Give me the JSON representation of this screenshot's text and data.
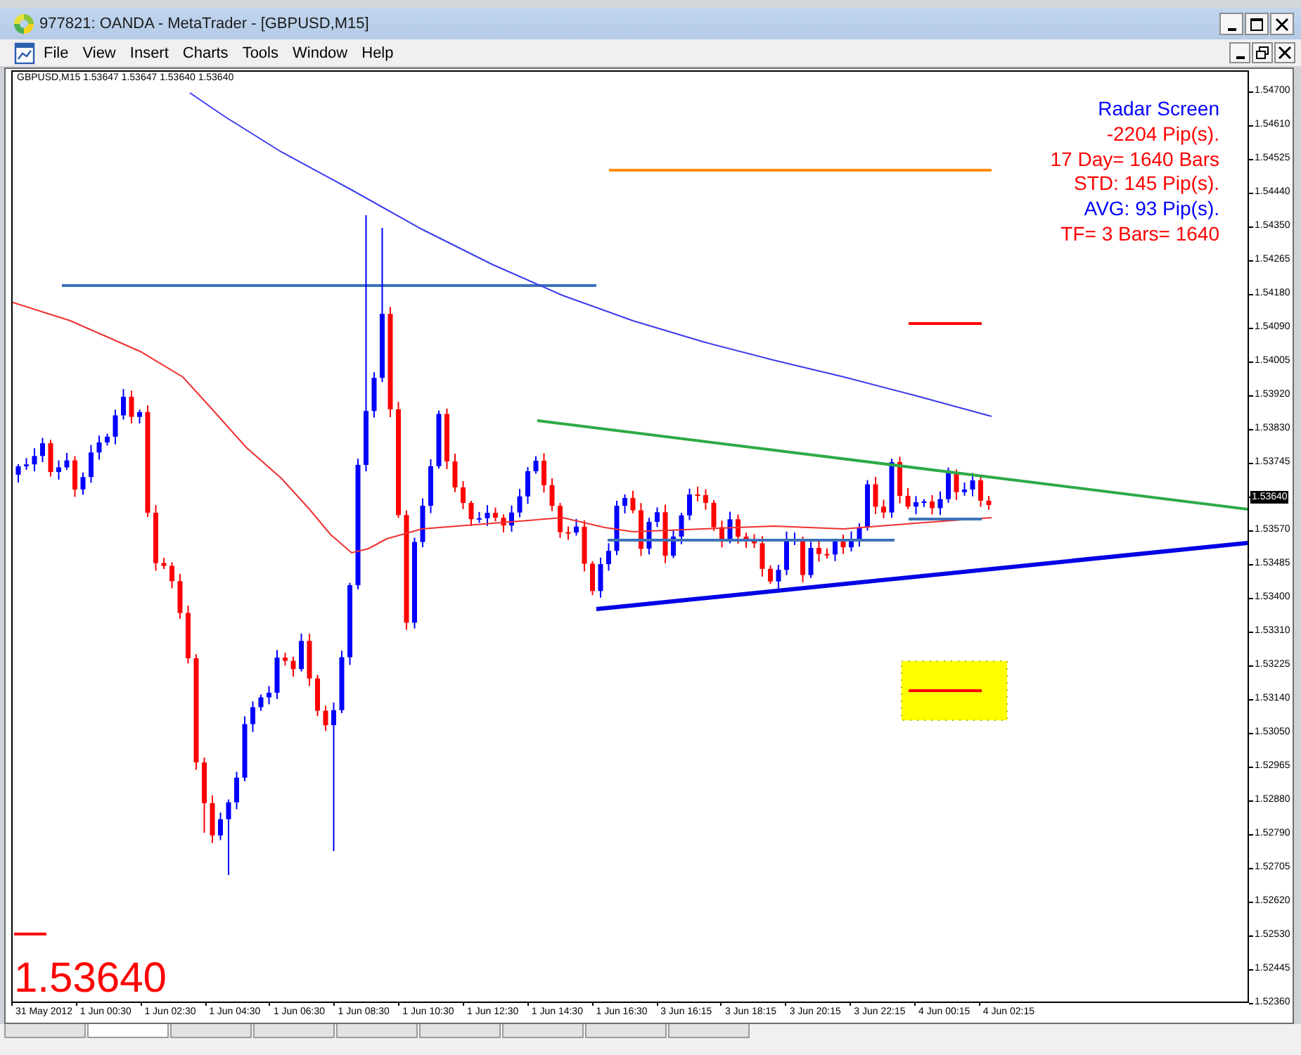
{
  "window": {
    "title": "977821: OANDA - MetaTrader - [GBPUSD,M15]"
  },
  "menu": [
    "File",
    "View",
    "Insert",
    "Charts",
    "Tools",
    "Window",
    "Help"
  ],
  "chart": {
    "header": "GBPUSD,M15 1.53647 1.53647 1.53640 1.53640",
    "radar_screen": [
      {
        "text": "Radar Screen",
        "color": "#0000ff"
      },
      {
        "text": "-2204 Pip(s).",
        "color": "#ff0000"
      },
      {
        "text": "17 Day= 1640 Bars",
        "color": "#ff0000"
      },
      {
        "text": "STD: 145 Pip(s).",
        "color": "#ff0000"
      },
      {
        "text": "AVG: 93 Pip(s).",
        "color": "#0000ff"
      },
      {
        "text": "TF= 3 Bars= 1640",
        "color": "#ff0000"
      }
    ],
    "last_price": "1.53640",
    "price_axis": {
      "labels_above": [
        "1.54700",
        "1.54610",
        "1.54525",
        "1.54440",
        "1.54350",
        "1.54265",
        "1.54180",
        "1.54090",
        "1.54005",
        "1.53920",
        "1.53830",
        "1.53745"
      ],
      "current_price": "1.53640",
      "labels_below": [
        "1.53570",
        "1.53485",
        "1.53400",
        "1.53310",
        "1.53225",
        "1.53140",
        "1.53050",
        "1.52965",
        "1.52880",
        "1.52790",
        "1.52705",
        "1.52620",
        "1.52530",
        "1.52445",
        "1.52360"
      ]
    },
    "time_axis": [
      "31 May 2012",
      "1 Jun 00:30",
      "1 Jun 02:30",
      "1 Jun 04:30",
      "1 Jun 06:30",
      "1 Jun 08:30",
      "1 Jun 10:30",
      "1 Jun 12:30",
      "1 Jun 14:30",
      "1 Jun 16:30",
      "3 Jun 16:15",
      "3 Jun 18:15",
      "3 Jun 20:15",
      "3 Jun 22:15",
      "4 Jun 00:15",
      "4 Jun 02:15"
    ]
  },
  "chart_tabs": [
    {
      "selected": false
    },
    {
      "selected": true
    },
    {
      "selected": false
    },
    {
      "selected": false
    },
    {
      "selected": false
    },
    {
      "selected": false
    },
    {
      "selected": false
    },
    {
      "selected": false
    },
    {
      "selected": false
    }
  ]
}
